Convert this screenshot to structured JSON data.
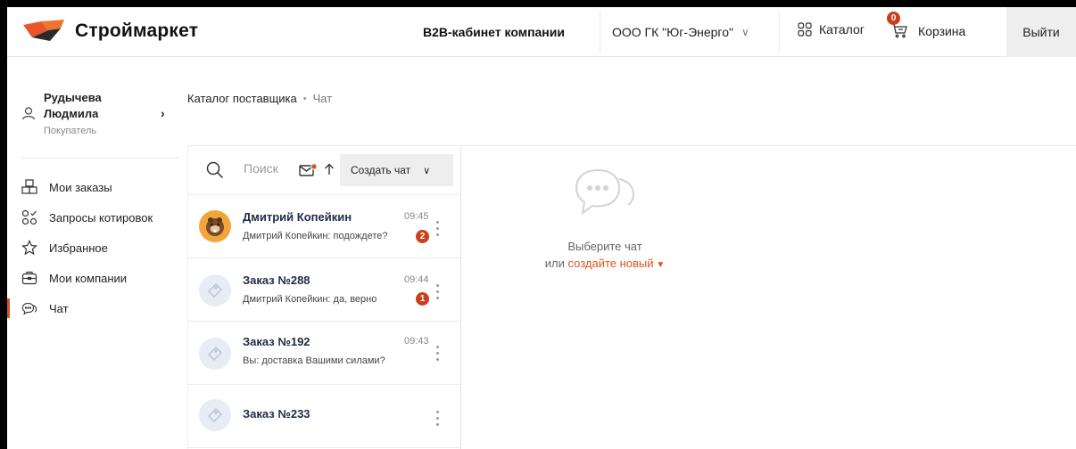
{
  "header": {
    "logo_text": "Строймаркет",
    "cabinet_title": "B2B-кабинет компании",
    "company": "ООО ГК \"Юг-Энерго\"",
    "catalog_label": "Каталог",
    "cart_label": "Корзина",
    "cart_count": "0",
    "logout_label": "Выйти"
  },
  "user": {
    "name_line1": "Рудычева",
    "name_line2": "Людмила",
    "role": "Покупатель"
  },
  "sidebar": {
    "items": [
      {
        "label": "Мои заказы",
        "icon": "boxes-icon"
      },
      {
        "label": "Запросы котировок",
        "icon": "quotes-icon"
      },
      {
        "label": "Избранное",
        "icon": "star-icon"
      },
      {
        "label": "Мои компании",
        "icon": "briefcase-icon"
      },
      {
        "label": "Чат",
        "icon": "chat-icon",
        "active": true
      }
    ]
  },
  "breadcrumb": {
    "parent": "Каталог поставщика",
    "current": "Чат"
  },
  "chat_list": {
    "search_placeholder": "Поиск",
    "create_label": "Создать чат",
    "items": [
      {
        "title": "Дмитрий Копейкин",
        "time": "09:45",
        "preview": "Дмитрий Копейкин: подождете?",
        "unread": "2"
      },
      {
        "title": "Заказ №288",
        "time": "09:44",
        "preview": "Дмитрий Копейкин: да, верно",
        "unread": "1"
      },
      {
        "title": "Заказ №192",
        "time": "09:43",
        "preview": "Вы: доставка Вашими силами?"
      },
      {
        "title": "Заказ №233"
      }
    ]
  },
  "empty_state": {
    "line1": "Выберите чат",
    "line2_prefix": "или",
    "line2_link": "создайте новый"
  },
  "colors": {
    "accent": "#d9541e",
    "badge": "#c9401a",
    "button_bg": "#eeeeee"
  }
}
